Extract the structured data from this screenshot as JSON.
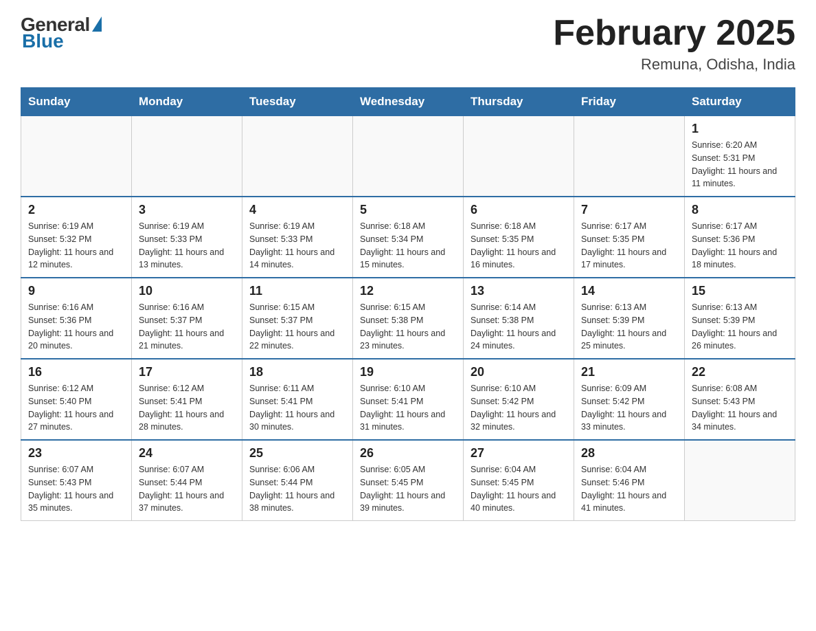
{
  "header": {
    "logo_general": "General",
    "logo_blue": "Blue",
    "month_title": "February 2025",
    "location": "Remuna, Odisha, India"
  },
  "days_of_week": [
    "Sunday",
    "Monday",
    "Tuesday",
    "Wednesday",
    "Thursday",
    "Friday",
    "Saturday"
  ],
  "weeks": [
    [
      {
        "day": "",
        "info": ""
      },
      {
        "day": "",
        "info": ""
      },
      {
        "day": "",
        "info": ""
      },
      {
        "day": "",
        "info": ""
      },
      {
        "day": "",
        "info": ""
      },
      {
        "day": "",
        "info": ""
      },
      {
        "day": "1",
        "info": "Sunrise: 6:20 AM\nSunset: 5:31 PM\nDaylight: 11 hours and 11 minutes."
      }
    ],
    [
      {
        "day": "2",
        "info": "Sunrise: 6:19 AM\nSunset: 5:32 PM\nDaylight: 11 hours and 12 minutes."
      },
      {
        "day": "3",
        "info": "Sunrise: 6:19 AM\nSunset: 5:33 PM\nDaylight: 11 hours and 13 minutes."
      },
      {
        "day": "4",
        "info": "Sunrise: 6:19 AM\nSunset: 5:33 PM\nDaylight: 11 hours and 14 minutes."
      },
      {
        "day": "5",
        "info": "Sunrise: 6:18 AM\nSunset: 5:34 PM\nDaylight: 11 hours and 15 minutes."
      },
      {
        "day": "6",
        "info": "Sunrise: 6:18 AM\nSunset: 5:35 PM\nDaylight: 11 hours and 16 minutes."
      },
      {
        "day": "7",
        "info": "Sunrise: 6:17 AM\nSunset: 5:35 PM\nDaylight: 11 hours and 17 minutes."
      },
      {
        "day": "8",
        "info": "Sunrise: 6:17 AM\nSunset: 5:36 PM\nDaylight: 11 hours and 18 minutes."
      }
    ],
    [
      {
        "day": "9",
        "info": "Sunrise: 6:16 AM\nSunset: 5:36 PM\nDaylight: 11 hours and 20 minutes."
      },
      {
        "day": "10",
        "info": "Sunrise: 6:16 AM\nSunset: 5:37 PM\nDaylight: 11 hours and 21 minutes."
      },
      {
        "day": "11",
        "info": "Sunrise: 6:15 AM\nSunset: 5:37 PM\nDaylight: 11 hours and 22 minutes."
      },
      {
        "day": "12",
        "info": "Sunrise: 6:15 AM\nSunset: 5:38 PM\nDaylight: 11 hours and 23 minutes."
      },
      {
        "day": "13",
        "info": "Sunrise: 6:14 AM\nSunset: 5:38 PM\nDaylight: 11 hours and 24 minutes."
      },
      {
        "day": "14",
        "info": "Sunrise: 6:13 AM\nSunset: 5:39 PM\nDaylight: 11 hours and 25 minutes."
      },
      {
        "day": "15",
        "info": "Sunrise: 6:13 AM\nSunset: 5:39 PM\nDaylight: 11 hours and 26 minutes."
      }
    ],
    [
      {
        "day": "16",
        "info": "Sunrise: 6:12 AM\nSunset: 5:40 PM\nDaylight: 11 hours and 27 minutes."
      },
      {
        "day": "17",
        "info": "Sunrise: 6:12 AM\nSunset: 5:41 PM\nDaylight: 11 hours and 28 minutes."
      },
      {
        "day": "18",
        "info": "Sunrise: 6:11 AM\nSunset: 5:41 PM\nDaylight: 11 hours and 30 minutes."
      },
      {
        "day": "19",
        "info": "Sunrise: 6:10 AM\nSunset: 5:41 PM\nDaylight: 11 hours and 31 minutes."
      },
      {
        "day": "20",
        "info": "Sunrise: 6:10 AM\nSunset: 5:42 PM\nDaylight: 11 hours and 32 minutes."
      },
      {
        "day": "21",
        "info": "Sunrise: 6:09 AM\nSunset: 5:42 PM\nDaylight: 11 hours and 33 minutes."
      },
      {
        "day": "22",
        "info": "Sunrise: 6:08 AM\nSunset: 5:43 PM\nDaylight: 11 hours and 34 minutes."
      }
    ],
    [
      {
        "day": "23",
        "info": "Sunrise: 6:07 AM\nSunset: 5:43 PM\nDaylight: 11 hours and 35 minutes."
      },
      {
        "day": "24",
        "info": "Sunrise: 6:07 AM\nSunset: 5:44 PM\nDaylight: 11 hours and 37 minutes."
      },
      {
        "day": "25",
        "info": "Sunrise: 6:06 AM\nSunset: 5:44 PM\nDaylight: 11 hours and 38 minutes."
      },
      {
        "day": "26",
        "info": "Sunrise: 6:05 AM\nSunset: 5:45 PM\nDaylight: 11 hours and 39 minutes."
      },
      {
        "day": "27",
        "info": "Sunrise: 6:04 AM\nSunset: 5:45 PM\nDaylight: 11 hours and 40 minutes."
      },
      {
        "day": "28",
        "info": "Sunrise: 6:04 AM\nSunset: 5:46 PM\nDaylight: 11 hours and 41 minutes."
      },
      {
        "day": "",
        "info": ""
      }
    ]
  ]
}
